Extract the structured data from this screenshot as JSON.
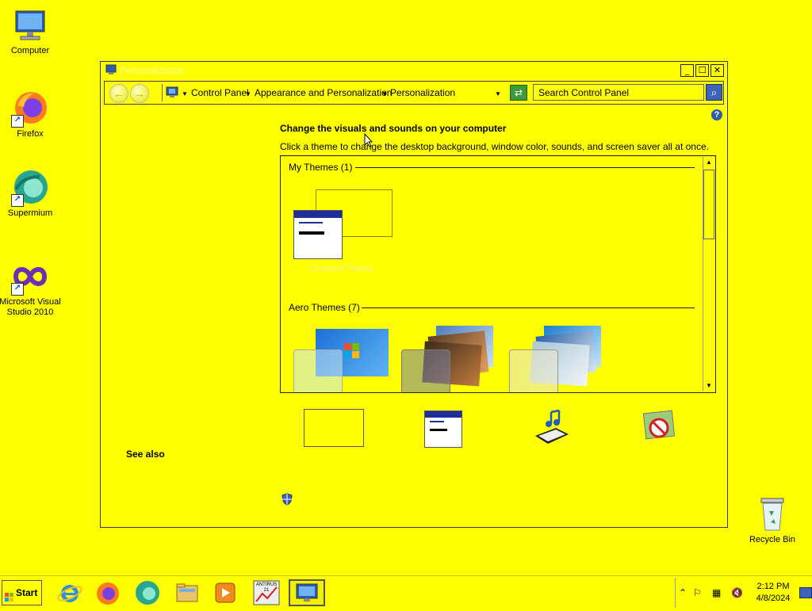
{
  "desktop": {
    "icons": [
      {
        "label": "Computer"
      },
      {
        "label": "Firefox"
      },
      {
        "label": "Supermium"
      },
      {
        "label": "Microsoft Visual Studio 2010"
      },
      {
        "label": "Recycle Bin"
      }
    ]
  },
  "window": {
    "title": "Personalization",
    "controls": {
      "minimize": "_",
      "maximize": "☐",
      "close": "✕"
    },
    "breadcrumb": [
      "Control Panel",
      "Appearance and Personalization",
      "Personalization"
    ],
    "search_placeholder": "Search Control Panel",
    "heading": "Change the visuals and sounds on your computer",
    "subtext": "Click a theme to change the desktop background, window color, sounds, and screen saver all at once.",
    "themes": {
      "my_themes_header": "My Themes (1)",
      "unsaved_theme_label": "Unsaved Theme",
      "aero_themes_header": "Aero Themes (7)"
    },
    "see_also": "See also"
  },
  "taskbar": {
    "start_label": "Start",
    "apps": [
      "internet-explorer",
      "firefox",
      "supermium",
      "file-explorer",
      "media-player",
      "antivirus",
      "control-panel"
    ],
    "antivirus_badge": "ANTIRUS 21",
    "clock_time": "2:12 PM",
    "clock_date": "4/8/2024"
  },
  "colors": {
    "desktop_bg": "#ffff00",
    "selection_accent": "#1e2f9a"
  }
}
